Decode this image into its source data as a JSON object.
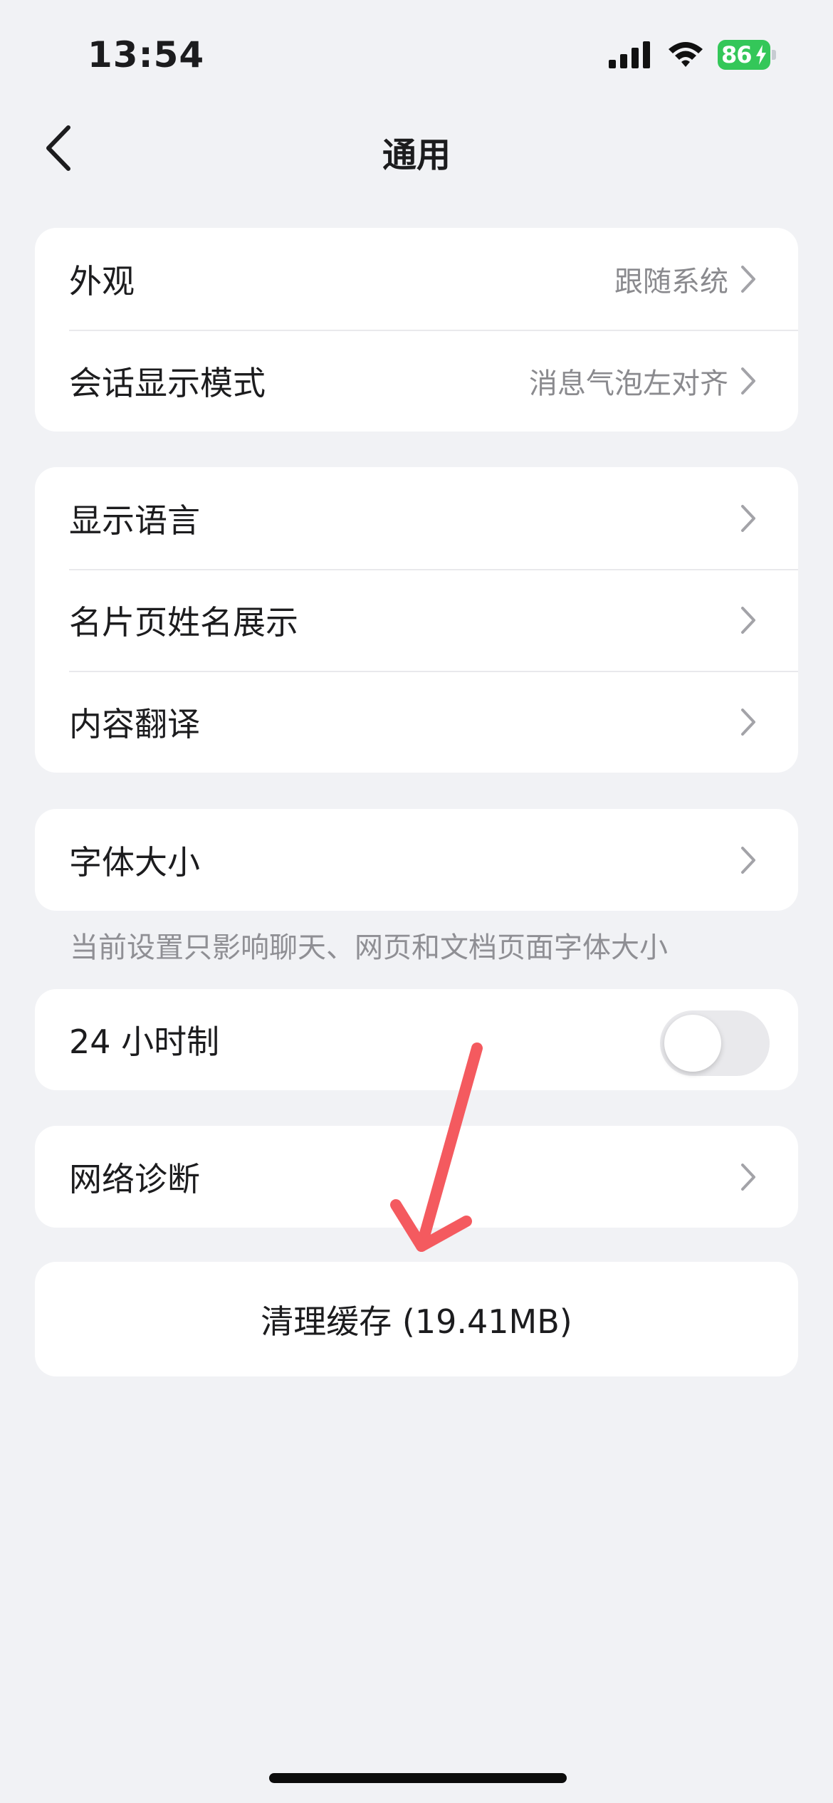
{
  "status_bar": {
    "time": "13:54",
    "battery_level": "86",
    "battery_color": "#34c759"
  },
  "nav": {
    "title": "通用",
    "back_icon": "chevron-left-icon"
  },
  "groups": [
    {
      "rows": [
        {
          "label": "外观",
          "value": "跟随系统"
        },
        {
          "label": "会话显示模式",
          "value": "消息气泡左对齐"
        }
      ]
    },
    {
      "rows": [
        {
          "label": "显示语言"
        },
        {
          "label": "名片页姓名展示"
        },
        {
          "label": "内容翻译"
        }
      ]
    },
    {
      "rows": [
        {
          "label": "字体大小"
        }
      ]
    }
  ],
  "font_size_caption": "当前设置只影响聊天、网页和文档页面字体大小",
  "time_format": {
    "label": "24 小时制",
    "enabled": false
  },
  "network": {
    "label": "网络诊断"
  },
  "clear_cache": {
    "label": "清理缓存 (19.41MB)"
  },
  "annotation": {
    "arrow_color": "#f45a5f"
  }
}
